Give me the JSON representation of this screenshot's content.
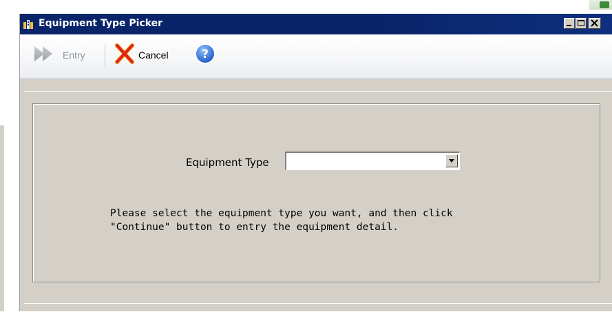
{
  "window": {
    "title": "Equipment Type Picker",
    "icon": "app-building-icon",
    "controls": [
      "minimize-icon",
      "maximize-icon",
      "close-icon"
    ]
  },
  "toolbar": {
    "entry_label": "Entry",
    "entry_icon": "double-arrow-right-icon",
    "cancel_label": "Cancel",
    "cancel_icon": "red-x-icon",
    "help_icon": "help-icon"
  },
  "form": {
    "equipment_type_label": "Equipment Type",
    "equipment_type_value": "",
    "instruction_line1": "Please select the equipment type you want, and then click",
    "instruction_line2": "\"Continue\" button to entry the equipment detail."
  },
  "colors": {
    "titlebar": "#0a246a",
    "window_face": "#d4d0c8",
    "cancel_x": "#e02020",
    "help_blue": "#1f6fd6",
    "entry_disabled": "#9aa0a6"
  }
}
